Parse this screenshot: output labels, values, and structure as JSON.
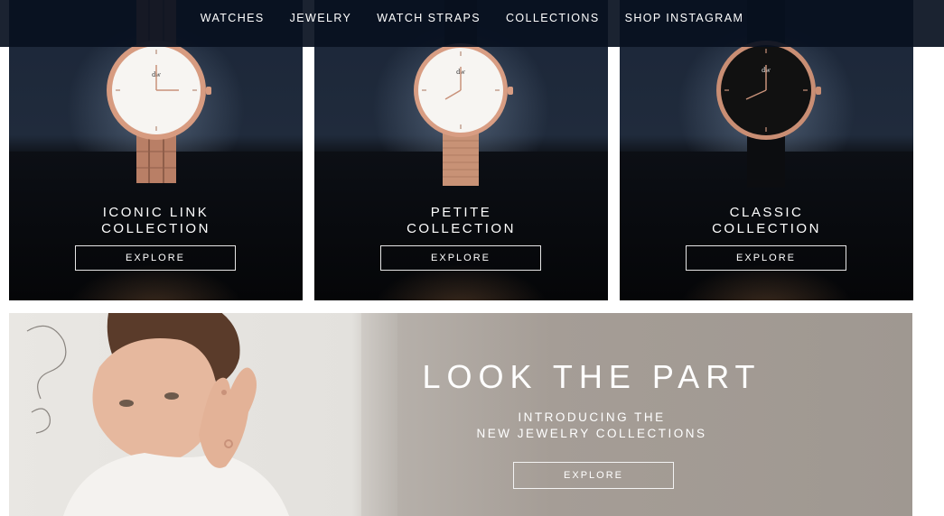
{
  "nav": {
    "items": [
      "WATCHES",
      "JEWELRY",
      "WATCH STRAPS",
      "COLLECTIONS",
      "SHOP INSTAGRAM"
    ]
  },
  "collections": [
    {
      "title_line1": "ICONIC LINK",
      "title_line2": "COLLECTION",
      "button": "EXPLORE",
      "dial_color": "#f7f5f2",
      "logo": "dw"
    },
    {
      "title_line1": "PETITE",
      "title_line2": "COLLECTION",
      "button": "EXPLORE",
      "dial_color": "#f7f5f2",
      "logo": "dw"
    },
    {
      "title_line1": "CLASSIC",
      "title_line2": "COLLECTION",
      "button": "EXPLORE",
      "dial_color": "#111111",
      "logo": "dw"
    }
  ],
  "banner": {
    "headline": "LOOK THE PART",
    "sub_line1": "INTRODUCING THE",
    "sub_line2": "NEW JEWELRY COLLECTIONS",
    "button": "EXPLORE"
  },
  "colors": {
    "nav_bg": "#081020",
    "rose_gold": "#c9927a",
    "white": "#ffffff"
  }
}
